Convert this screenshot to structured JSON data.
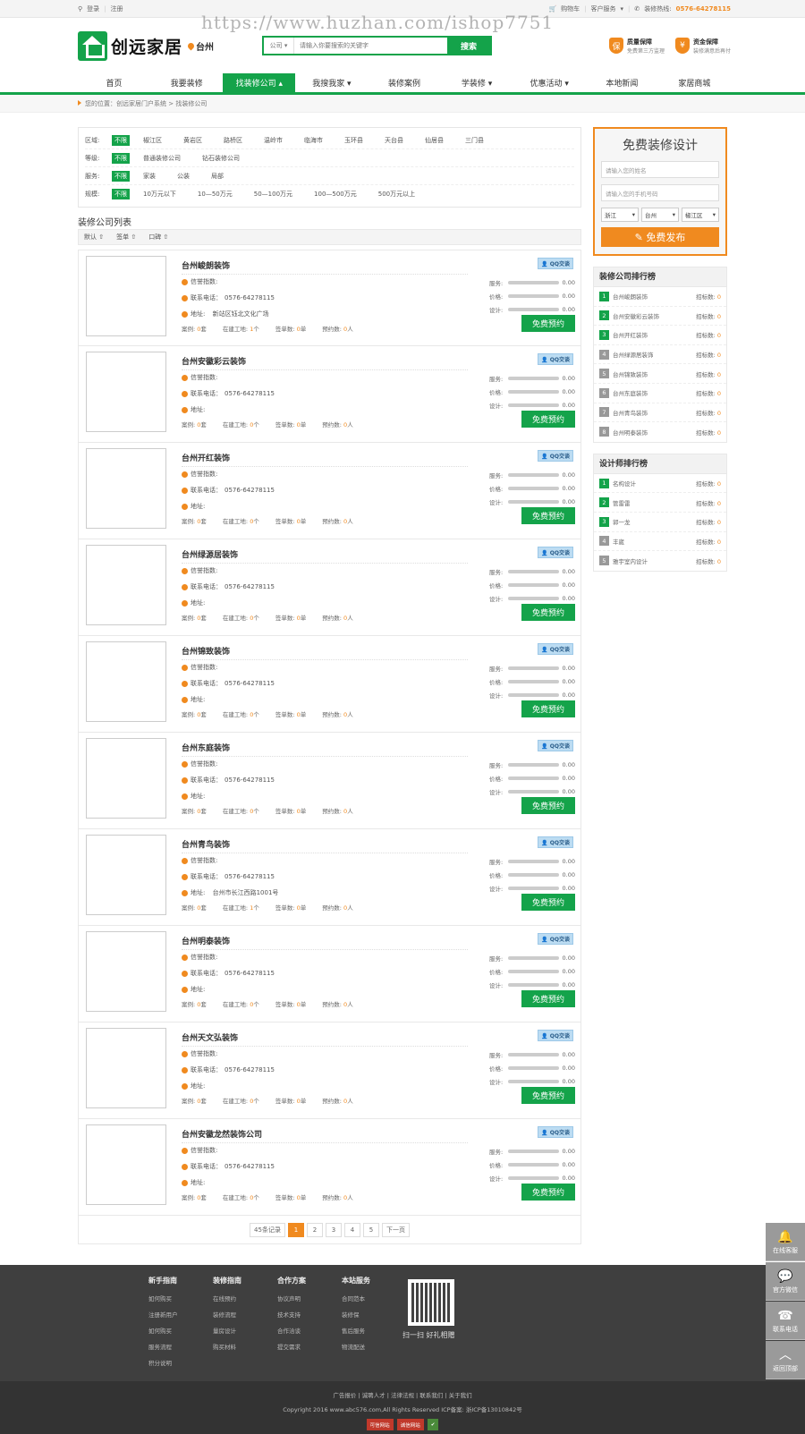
{
  "watermark": "https://www.huzhan.com/ishop7751",
  "topbar": {
    "login": "登录",
    "register": "注册",
    "cart": "购物车",
    "service": "客户服务",
    "hotline_label": "装修热线:",
    "hotline": "0576-64278115"
  },
  "header": {
    "logo_text": "创远家居",
    "city": "台州",
    "search_type": "公司",
    "search_placeholder": "请输入你要搜索的关键字",
    "search_button": "搜索",
    "guarantee1_title": "质量保障",
    "guarantee1_sub": "免费第三方监理",
    "guarantee2_title": "资金保障",
    "guarantee2_sub": "装修满意后再付"
  },
  "nav": [
    "首页",
    "我要装修",
    "找装修公司 ▴",
    "我搜我家 ▾",
    "装修案例",
    "学装修 ▾",
    "优惠活动 ▾",
    "本地新闻",
    "家居商城"
  ],
  "breadcrumb": "您的位置：创远家居门户系统 > 找装修公司",
  "filters": [
    {
      "label": "区域:",
      "options": [
        "不限",
        "椒江区",
        "黄岩区",
        "路桥区",
        "温岭市",
        "临海市",
        "玉环县",
        "天台县",
        "仙居县",
        "三门县"
      ]
    },
    {
      "label": "等级:",
      "options": [
        "不限",
        "普通装修公司",
        "钻石装修公司"
      ]
    },
    {
      "label": "服务:",
      "options": [
        "不限",
        "家装",
        "公装",
        "局部"
      ]
    },
    {
      "label": "规模:",
      "options": [
        "不限",
        "10万元以下",
        "10—50万元",
        "50—100万元",
        "100—500万元",
        "500万元以上"
      ]
    }
  ],
  "list_title": "装修公司列表",
  "sort": [
    "默认 ⇧",
    "签单 ⇧",
    "口碑 ⇧"
  ],
  "card_labels": {
    "credit": "信誉指数:",
    "phone_label": "联系电话：",
    "addr": "地址:",
    "qq": "QQ交谈",
    "service": "服务:",
    "price": "价格:",
    "design": "设计:",
    "cases": "案例:",
    "sites": "在建工地:",
    "signs": "签单数:",
    "appts": "预约数:",
    "book": "免费预约",
    "unit_set": "套",
    "unit_ge": "个",
    "unit_dan": "单",
    "unit_ren": "人"
  },
  "companies": [
    {
      "name": "台州峻朗装饰",
      "phone": "0576-64278115",
      "addr": "新站区钰北文化广场",
      "cases": "0",
      "sites": "1",
      "signs": "0",
      "appts": "0",
      "service": "0.00",
      "price": "0.00",
      "design": "0.00"
    },
    {
      "name": "台州安徽彩云装饰",
      "phone": "0576-64278115",
      "addr": "",
      "cases": "0",
      "sites": "0",
      "signs": "0",
      "appts": "0",
      "service": "0.00",
      "price": "0.00",
      "design": "0.00"
    },
    {
      "name": "台州开红装饰",
      "phone": "0576-64278115",
      "addr": "",
      "cases": "0",
      "sites": "0",
      "signs": "0",
      "appts": "0",
      "service": "0.00",
      "price": "0.00",
      "design": "0.00"
    },
    {
      "name": "台州绿源居装饰",
      "phone": "0576-64278115",
      "addr": "",
      "cases": "0",
      "sites": "0",
      "signs": "0",
      "appts": "0",
      "service": "0.00",
      "price": "0.00",
      "design": "0.00"
    },
    {
      "name": "台州锦致装饰",
      "phone": "0576-64278115",
      "addr": "",
      "cases": "0",
      "sites": "0",
      "signs": "0",
      "appts": "0",
      "service": "0.00",
      "price": "0.00",
      "design": "0.00"
    },
    {
      "name": "台州东庭装饰",
      "phone": "0576-64278115",
      "addr": "",
      "cases": "0",
      "sites": "0",
      "signs": "0",
      "appts": "0",
      "service": "0.00",
      "price": "0.00",
      "design": "0.00"
    },
    {
      "name": "台州青鸟装饰",
      "phone": "0576-64278115",
      "addr": "台州市长江西路1001号",
      "cases": "0",
      "sites": "1",
      "signs": "0",
      "appts": "0",
      "service": "0.00",
      "price": "0.00",
      "design": "0.00"
    },
    {
      "name": "台州明泰装饰",
      "phone": "0576-64278115",
      "addr": "",
      "cases": "0",
      "sites": "0",
      "signs": "0",
      "appts": "0",
      "service": "0.00",
      "price": "0.00",
      "design": "0.00"
    },
    {
      "name": "台州天文弘装饰",
      "phone": "0576-64278115",
      "addr": "",
      "cases": "0",
      "sites": "0",
      "signs": "0",
      "appts": "0",
      "service": "0.00",
      "price": "0.00",
      "design": "0.00"
    },
    {
      "name": "台州安徽龙然装饰公司",
      "phone": "0576-64278115",
      "addr": "",
      "cases": "0",
      "sites": "0",
      "signs": "0",
      "appts": "0",
      "service": "0.00",
      "price": "0.00",
      "design": "0.00"
    }
  ],
  "pager": {
    "total": "45条记录",
    "pages": [
      "1",
      "2",
      "3",
      "4",
      "5"
    ],
    "next": "下一页"
  },
  "free_design": {
    "title": "免费装修设计",
    "name_ph": "请输入您的姓名",
    "phone_ph": "请输入您的手机号码",
    "province": "浙江",
    "city": "台州",
    "district": "椒江区",
    "submit": "免费发布"
  },
  "company_rank": {
    "title": "装修公司排行榜",
    "count_label": "招标数:",
    "items": [
      {
        "n": "1",
        "name": "台州峻朗装饰",
        "c": "0"
      },
      {
        "n": "2",
        "name": "台州安徽彩云装饰",
        "c": "0"
      },
      {
        "n": "3",
        "name": "台州开红装饰",
        "c": "0"
      },
      {
        "n": "4",
        "name": "台州绿源居装饰",
        "c": "0"
      },
      {
        "n": "5",
        "name": "台州锦致装饰",
        "c": "0"
      },
      {
        "n": "6",
        "name": "台州东庭装饰",
        "c": "0"
      },
      {
        "n": "7",
        "name": "台州青鸟装饰",
        "c": "0"
      },
      {
        "n": "8",
        "name": "台州明泰装饰",
        "c": "0"
      }
    ]
  },
  "designer_rank": {
    "title": "设计师排行榜",
    "count_label": "招标数:",
    "items": [
      {
        "n": "1",
        "name": "名构设计",
        "c": "0"
      },
      {
        "n": "2",
        "name": "管雷雷",
        "c": "0"
      },
      {
        "n": "3",
        "name": "郭一龙",
        "c": "0"
      },
      {
        "n": "4",
        "name": "丰崴",
        "c": "0"
      },
      {
        "n": "5",
        "name": "雅宇室内设计",
        "c": "0"
      }
    ]
  },
  "footer": {
    "cols": [
      {
        "title": "新手指南",
        "items": [
          "如何购买",
          "注册新用户",
          "如何购买",
          "服务流程",
          "积分说明"
        ]
      },
      {
        "title": "装修指南",
        "items": [
          "在线预约",
          "装修流程",
          "量房设计",
          "购买材料"
        ]
      },
      {
        "title": "合作方案",
        "items": [
          "协议声明",
          "技术支持",
          "合作洽谈",
          "提交需求"
        ]
      },
      {
        "title": "本站服务",
        "items": [
          "合同范本",
          "装修保",
          "售后服务",
          "物流配送"
        ]
      }
    ],
    "qr_caption": "扫一扫 好礼相赠",
    "links": "广告报价 | 诚聘人才 | 法律法规 | 联系我们 | 关于我们",
    "copyright": "Copyright 2016 www.abc576.com,All Rights Reserved ICP备案: 浙ICP备13010842号",
    "badge1": "可信网站",
    "badge2": "诚信网站"
  },
  "float": [
    "在线客服",
    "官方微信",
    "联系电话",
    "返回顶部"
  ]
}
